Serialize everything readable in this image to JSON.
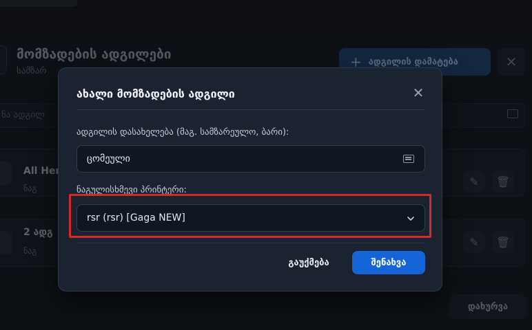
{
  "background": {
    "title": "მომზადების ადგილები",
    "subtitle": "სამზარ",
    "add_button_label": "ადგილის დამატება",
    "search_placeholder": "ნა ადგილ",
    "rows": [
      {
        "name": "All Her",
        "sub": "ნაგ"
      },
      {
        "name": "2 ადგ",
        "sub": "ნაგ"
      }
    ],
    "footer_button_label": "დახურვა"
  },
  "modal": {
    "title": "ახალი მომზადების ადგილი",
    "name_label": "ადგილის დასახელება (მაგ. სამზარეულო, ბარი):",
    "name_value": "ცომეული",
    "printer_label": "ნაგულისხმევი პრინტერი:",
    "printer_value": "rsr (rsr) [Gaga NEW]",
    "cancel_label": "გაუქმება",
    "save_label": "შენახვა"
  },
  "colors": {
    "accent": "#1565d8",
    "highlight": "#d42a2a",
    "modal_bg": "#1b2330"
  }
}
